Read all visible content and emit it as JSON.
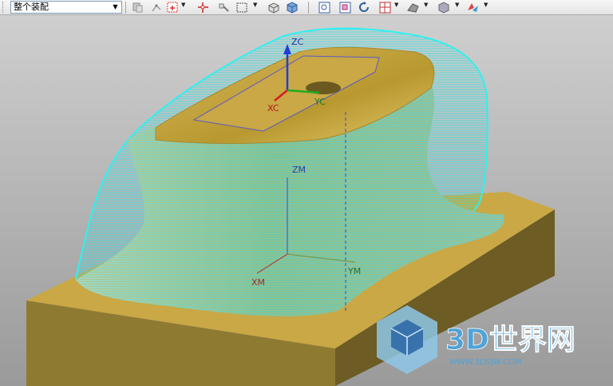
{
  "toolbar": {
    "filter_value": "整个装配",
    "icons": [
      "component-filter-icon",
      "snap-point-icon",
      "point-add-icon",
      "point-cross-icon",
      "key-pin-icon",
      "box-select-icon",
      "view-cube-icon",
      "solid-cube-icon",
      "fit-view-icon",
      "zoom-icon",
      "rotate-icon",
      "layer-grid-icon",
      "render-style-icon",
      "shading-icon",
      "orient-icon"
    ]
  },
  "viewport": {
    "axis_labels": {
      "zc": "ZC",
      "yc": "YC",
      "xc": "XC",
      "zm": "ZM",
      "ym": "YM",
      "xm": "XM"
    },
    "watermark": {
      "brand": "3D世界网",
      "url": "WWW.3DSJW.COM"
    }
  },
  "colors": {
    "background_top": "#cfcfcf",
    "background_bottom": "#9a9a9a",
    "base_block": "#c9a845",
    "toolpath": "#30e6e6",
    "wcs_z": "#1f3fd6",
    "wcs_x": "#d01f1f",
    "wcs_y": "#1faa1f"
  }
}
